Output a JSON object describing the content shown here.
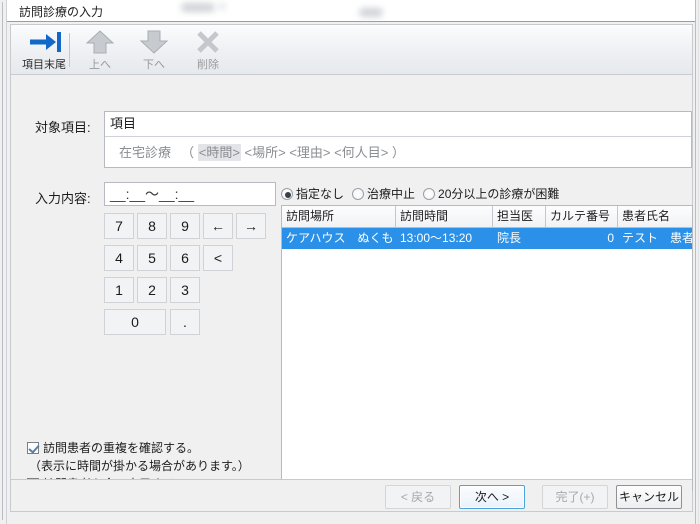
{
  "window": {
    "title": "訪問診療の入力"
  },
  "toolbar": {
    "buttons": [
      {
        "label": "項目末尾",
        "icon": "arrow-right-to-bar-icon",
        "enabled": true
      },
      {
        "label": "上へ",
        "icon": "arrow-up-icon",
        "enabled": false
      },
      {
        "label": "下へ",
        "icon": "arrow-down-icon",
        "enabled": false
      },
      {
        "label": "削除",
        "icon": "close-x-icon",
        "enabled": false
      }
    ]
  },
  "target_item": {
    "label": "対象項目:",
    "header": "項目",
    "content_prefix": "在宅診療 　（ ",
    "tag_time": "<時間>",
    "content_rest": " <場所> <理由> <何人目> ）"
  },
  "input_content": {
    "label": "入力内容:",
    "value": "__:__～__:__",
    "keys": [
      {
        "label": "7"
      },
      {
        "label": "8"
      },
      {
        "label": "9"
      },
      {
        "label": "←"
      },
      {
        "label": "→"
      },
      {
        "label": "4"
      },
      {
        "label": "5"
      },
      {
        "label": "6"
      },
      {
        "label": "<"
      },
      {
        "label": "1"
      },
      {
        "label": "2"
      },
      {
        "label": "3"
      },
      {
        "label": "0"
      },
      {
        "label": "."
      }
    ]
  },
  "radios": [
    {
      "label": "指定なし",
      "selected": true
    },
    {
      "label": "治療中止",
      "selected": false
    },
    {
      "label": "20分以上の診療が困難",
      "selected": false
    }
  ],
  "table": {
    "columns": [
      "訪問場所",
      "訪問時間",
      "担当医",
      "カルテ番号",
      "患者氏名"
    ],
    "rows": [
      {
        "place": "ケアハウス　ぬくもり",
        "time": "13:00～13:20",
        "doctor": "院長",
        "chart_no": "0",
        "patient": "テスト　患者",
        "selected": true
      }
    ]
  },
  "checkboxes": {
    "duplicate_check": {
      "label": "訪問患者の重複を確認する。",
      "checked": true
    },
    "note": "（表示に時間が掛かる場合があります。）",
    "show_all": {
      "label": "訪問患者を全て表示する。",
      "checked": true
    }
  },
  "footer": {
    "back": {
      "label": "< 戻る",
      "enabled": false
    },
    "next": {
      "label": "次へ >",
      "enabled": true,
      "focused": true
    },
    "finish": {
      "label": "完了(+)",
      "enabled": false
    },
    "cancel": {
      "label": "キャンセル",
      "enabled": true
    }
  },
  "colors": {
    "selection_blue": "#2a90e8",
    "accent_icon_blue": "#1268c8",
    "focus_border": "#4aa3dd"
  }
}
